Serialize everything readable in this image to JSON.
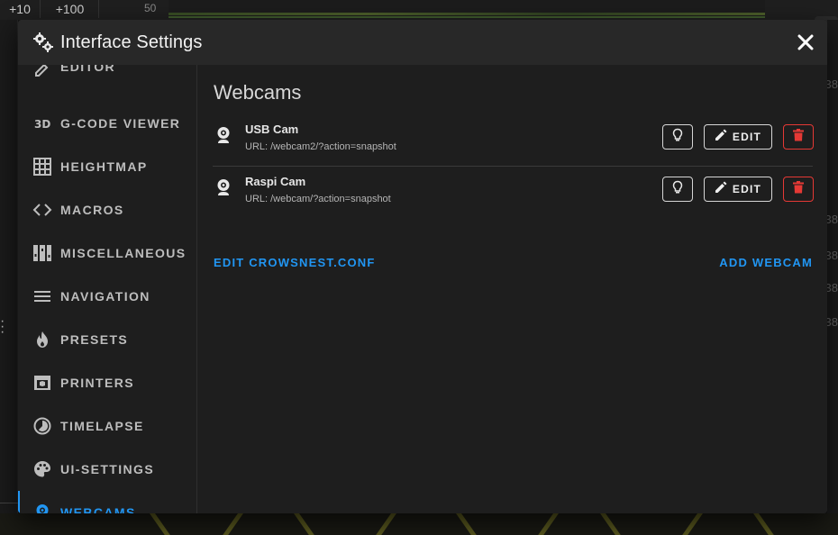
{
  "background": {
    "buttons": [
      "+10",
      "+100"
    ],
    "axis_value": "50",
    "side_text_right": "Se",
    "right_digits": "38"
  },
  "dialog": {
    "title": "Interface Settings",
    "close_icon": "close-icon",
    "settings_icon": "cogs-icon"
  },
  "sidebar": {
    "partial_item": {
      "label": "EDITOR",
      "icon": "editor-icon"
    },
    "items": [
      {
        "label": "G-CODE VIEWER",
        "icon": "3d-icon"
      },
      {
        "label": "HEIGHTMAP",
        "icon": "grid-icon"
      },
      {
        "label": "MACROS",
        "icon": "code-icon"
      },
      {
        "label": "MISCELLANEOUS",
        "icon": "sliders-icon"
      },
      {
        "label": "NAVIGATION",
        "icon": "menu-icon"
      },
      {
        "label": "PRESETS",
        "icon": "fire-icon"
      },
      {
        "label": "PRINTERS",
        "icon": "printer-3d-icon"
      },
      {
        "label": "TIMELAPSE",
        "icon": "timelapse-icon"
      },
      {
        "label": "UI-SETTINGS",
        "icon": "palette-icon"
      },
      {
        "label": "WEBCAMS",
        "icon": "webcam-icon",
        "active": true
      }
    ]
  },
  "webcams": {
    "title": "Webcams",
    "cams": [
      {
        "name": "USB Cam",
        "url": "URL: /webcam2/?action=snapshot"
      },
      {
        "name": "Raspi Cam",
        "url": "URL: /webcam/?action=snapshot"
      }
    ],
    "edit_label": "EDIT",
    "edit_crowsnest_label": "EDIT CROWSNEST.CONF",
    "add_webcam_label": "ADD WEBCAM"
  },
  "colors": {
    "accent": "#2196f3",
    "danger": "#e53935",
    "dialog_bg": "#1e1e1e",
    "header_bg": "#282828"
  }
}
